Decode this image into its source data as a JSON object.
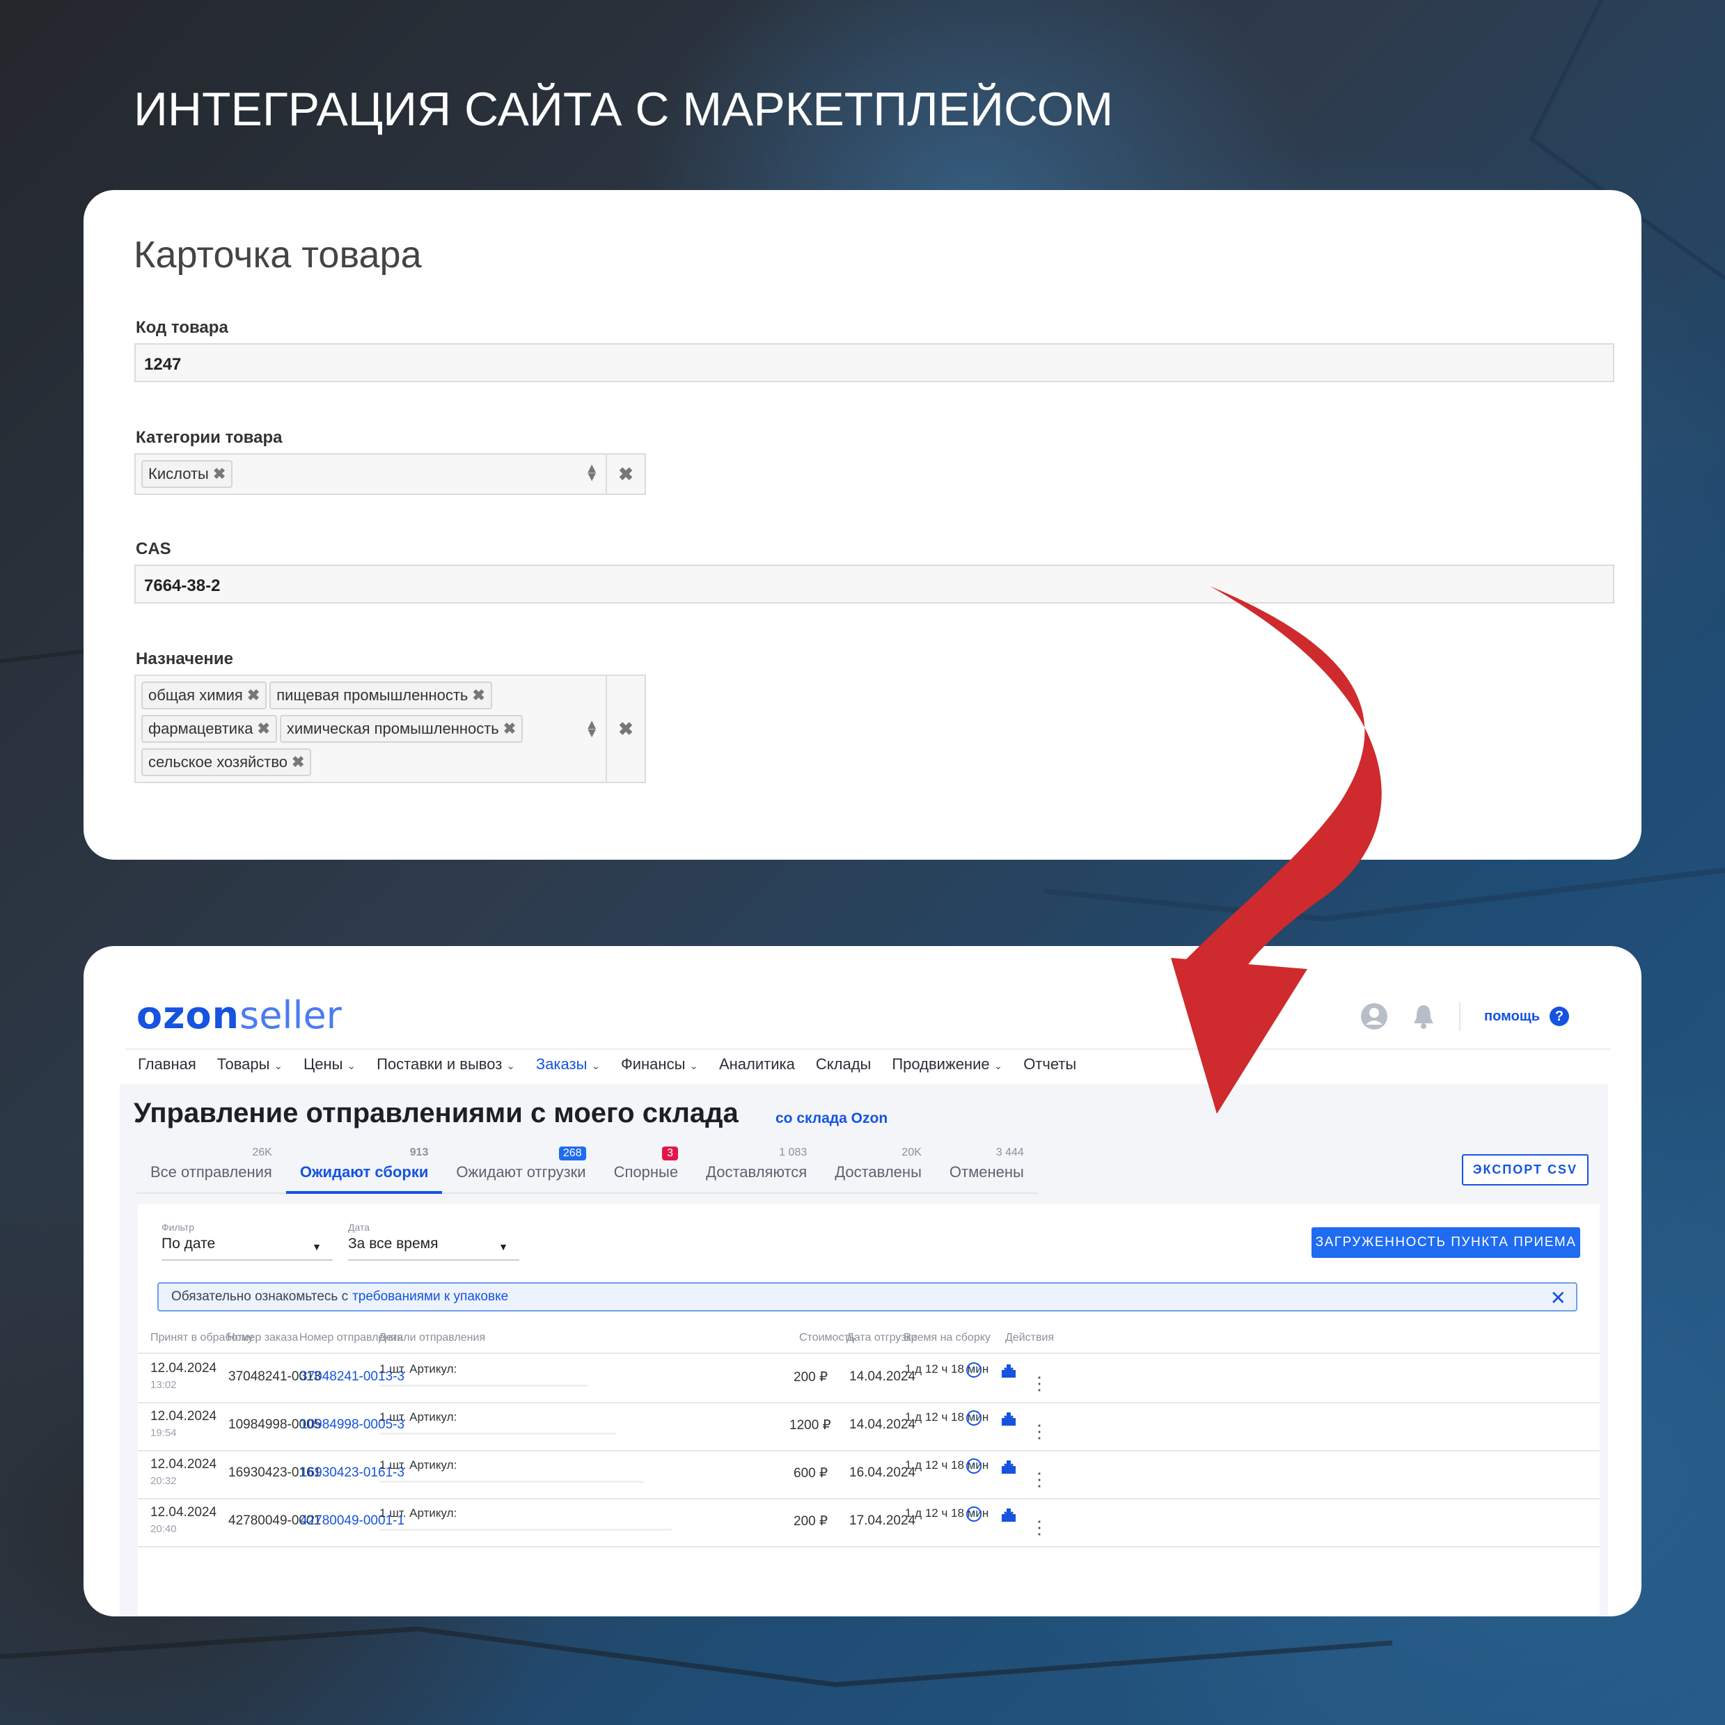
{
  "headline": "ИНТЕГРАЦИЯ САЙТА С МАРКЕТПЛЕЙСОМ",
  "form": {
    "title": "Карточка товара",
    "code_label": "Код товара",
    "code_value": "1247",
    "category_label": "Категории товара",
    "category_tags": [
      "Кислоты"
    ],
    "cas_label": "CAS",
    "cas_value": "7664-38-2",
    "purpose_label": "Назначение",
    "purpose_tags": [
      "общая химия",
      "пищевая промышленность",
      "фармацевтика",
      "химическая промышленность",
      "сельское хозяйство"
    ],
    "tag_remove_glyph": "✖",
    "clear_glyph": "✖"
  },
  "ozon": {
    "logo_brand": "ozon",
    "logo_product": "seller",
    "help_label": "помощь",
    "help_glyph": "?",
    "nav": [
      {
        "label": "Главная",
        "dropdown": false
      },
      {
        "label": "Товары",
        "dropdown": true
      },
      {
        "label": "Цены",
        "dropdown": true
      },
      {
        "label": "Поставки и вывоз",
        "dropdown": true
      },
      {
        "label": "Заказы",
        "dropdown": true,
        "active": true
      },
      {
        "label": "Финансы",
        "dropdown": true
      },
      {
        "label": "Аналитика",
        "dropdown": false
      },
      {
        "label": "Склады",
        "dropdown": false
      },
      {
        "label": "Продвижение",
        "dropdown": true
      },
      {
        "label": "Отчеты",
        "dropdown": false
      }
    ],
    "page_title": "Управление отправлениями с моего склада",
    "page_sub": "со склада Ozon",
    "tabs": [
      {
        "label": "Все отправления",
        "count": "26K"
      },
      {
        "label": "Ожидают сборки",
        "count": "913",
        "active": true
      },
      {
        "label": "Ожидают отгрузки",
        "count": "268",
        "badge": "blue"
      },
      {
        "label": "Спорные",
        "count": "3",
        "badge": "red"
      },
      {
        "label": "Доставляются",
        "count": "1 083"
      },
      {
        "label": "Доставлены",
        "count": "20K"
      },
      {
        "label": "Отменены",
        "count": "3 444"
      }
    ],
    "export_label": "ЭКСПОРТ CSV",
    "filter": {
      "label": "Фильтр",
      "value": "По дате"
    },
    "date": {
      "label": "Дата",
      "value": "За все время"
    },
    "load_button": "ЗАГРУЖЕННОСТЬ ПУНКТА ПРИЕМА",
    "notice_text": "Обязательно ознакомьтесь с",
    "notice_link": "требованиями к упаковке",
    "notice_close": "✕",
    "columns": [
      "Принят в обработку",
      "Номер заказа",
      "Номер отправления",
      "Детали отправления",
      "Стоимость",
      "Дата отгрузки",
      "Время на сборку",
      "Действия"
    ],
    "rows": [
      {
        "date": "12.04.2024",
        "time": "13:02",
        "order": "37048241-0013",
        "shipment": "37048241-0013-3",
        "details": "1 шт.   Артикул:",
        "price": "200 ₽",
        "ship_date": "14.04.2024",
        "assembly": "1 д 12 ч 18 мин"
      },
      {
        "date": "12.04.2024",
        "time": "19:54",
        "order": "10984998-0005",
        "shipment": "10984998-0005-3",
        "details": "1 шт.   Артикул:",
        "price": "1200 ₽",
        "ship_date": "14.04.2024",
        "assembly": "1 д 12 ч 18 мин"
      },
      {
        "date": "12.04.2024",
        "time": "20:32",
        "order": "16930423-0161",
        "shipment": "16930423-0161-3",
        "details": "1 шт.   Артикул:",
        "price": "600 ₽",
        "ship_date": "16.04.2024",
        "assembly": "1 д 12 ч 18 мин"
      },
      {
        "date": "12.04.2024",
        "time": "20:40",
        "order": "42780049-0001",
        "shipment": "42780049-0001-1",
        "details": "1 шт.   Артикул:",
        "price": "200 ₽",
        "ship_date": "17.04.2024",
        "assembly": "1 д 12 ч 18 мин"
      }
    ],
    "clock_glyph": "!",
    "more_glyph": "⋮"
  },
  "colors": {
    "accent": "#1553e0",
    "arrow_red": "#d0282c",
    "badge_blue": "#1f6cf0",
    "badge_red": "#e2164a"
  },
  "icons": [
    "user-icon",
    "bell-icon",
    "help-icon",
    "sort-icon",
    "clock-icon",
    "print-label-icon",
    "more-icon",
    "curved-arrow"
  ]
}
